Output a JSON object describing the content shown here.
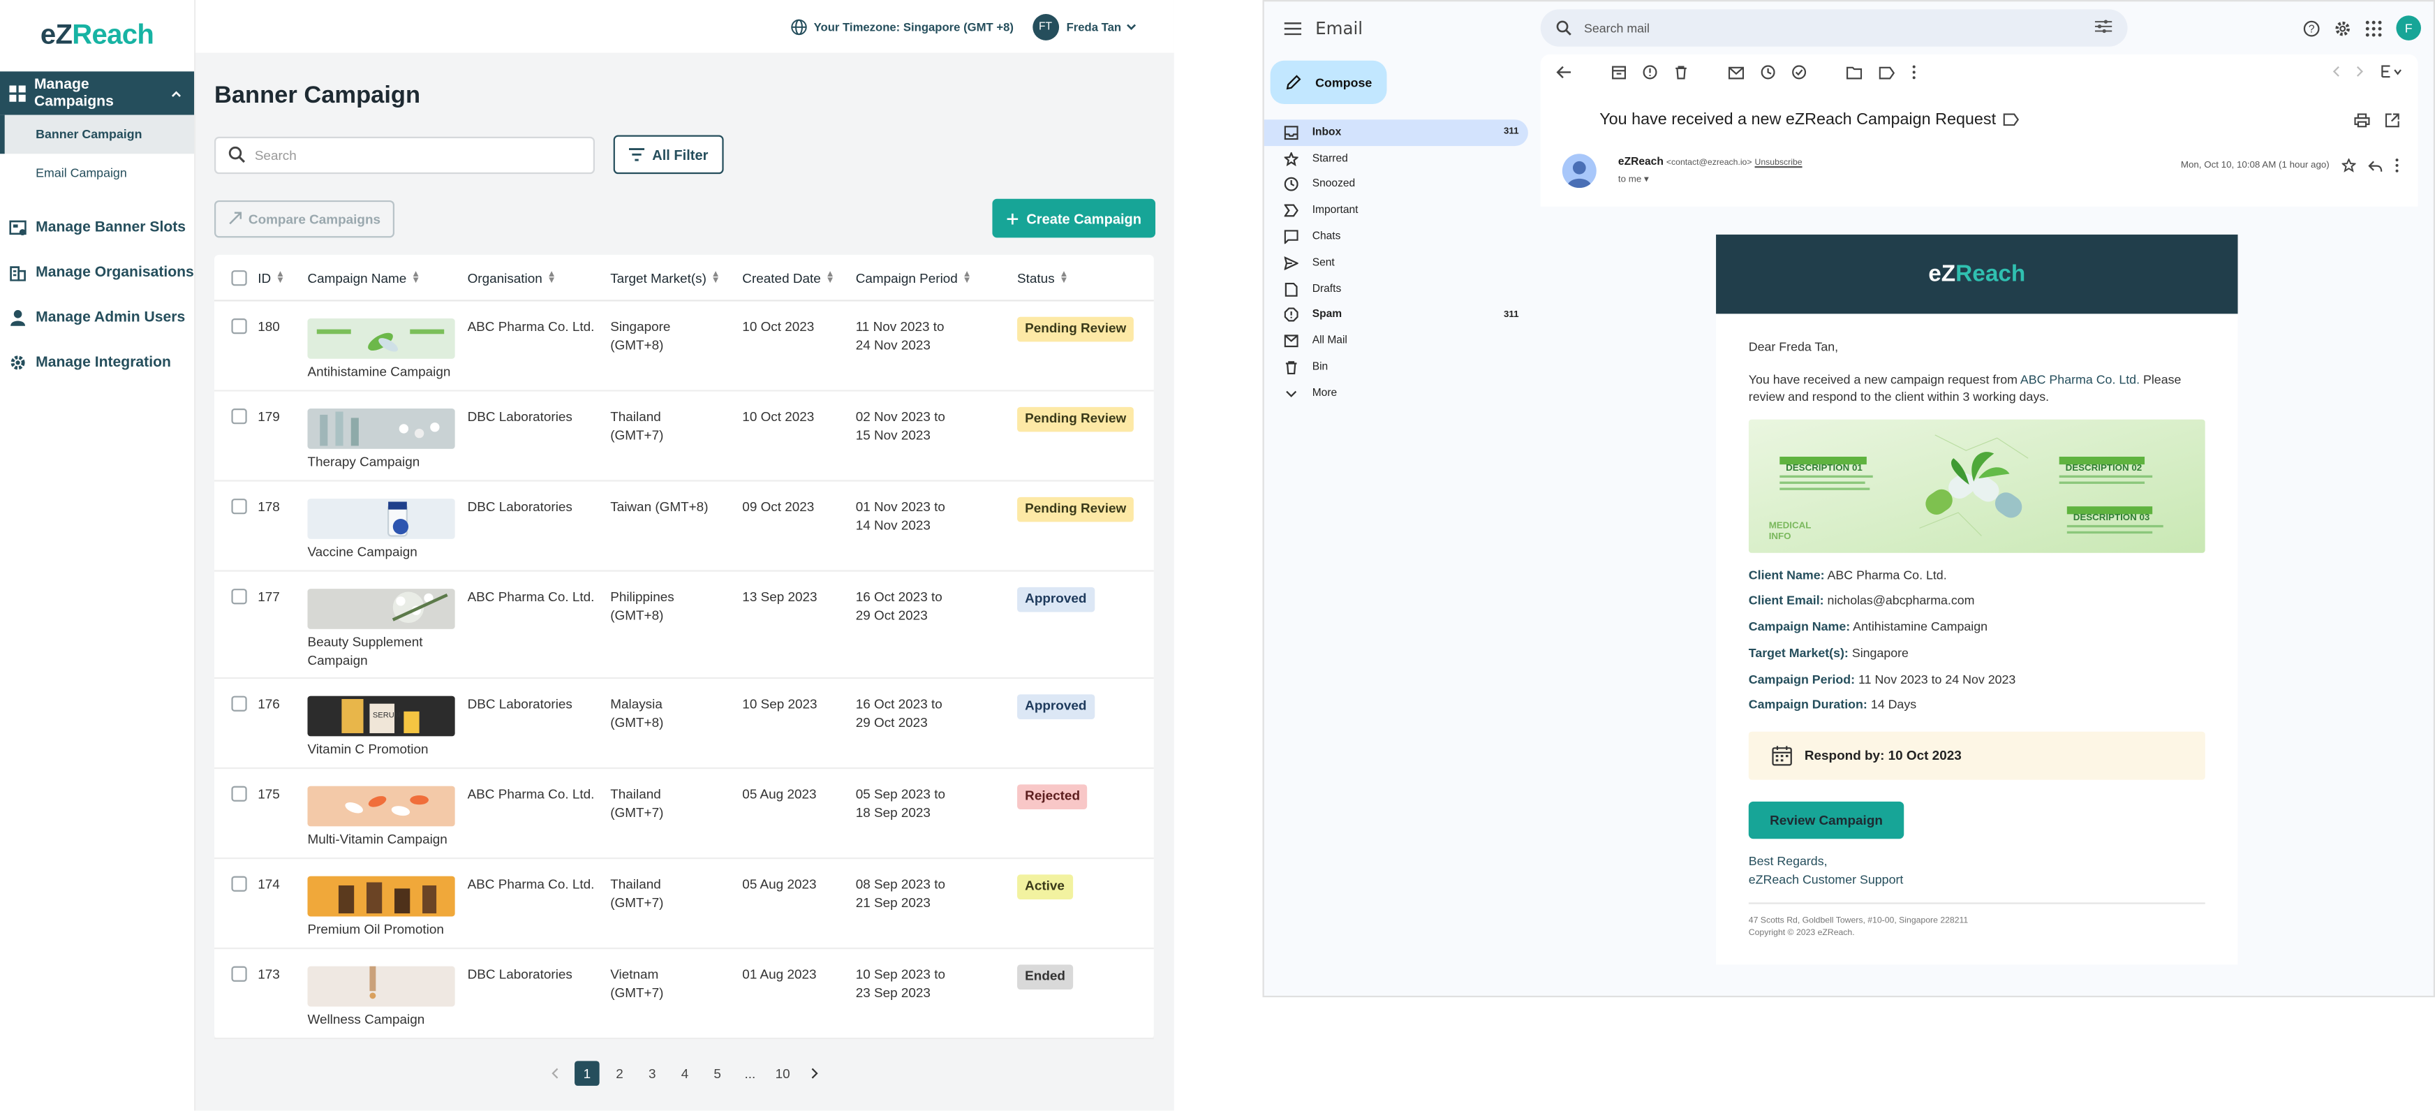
{
  "app": {
    "logo": {
      "part1": "eZ",
      "part2": "Reach"
    },
    "sidebar": {
      "section": "Manage Campaigns",
      "subitems": [
        {
          "label": "Banner Campaign",
          "active": true
        },
        {
          "label": "Email Campaign",
          "active": false
        }
      ],
      "items": [
        {
          "label": "Manage Banner Slots",
          "icon": "banner-slots-icon"
        },
        {
          "label": "Manage Organisations",
          "icon": "building-icon"
        },
        {
          "label": "Manage Admin Users",
          "icon": "user-icon"
        },
        {
          "label": "Manage Integration",
          "icon": "gear-icon"
        }
      ]
    },
    "topbar": {
      "timezone": "Your Timezone: Singapore (GMT +8)",
      "avatar_initials": "FT",
      "user_name": "Freda Tan"
    },
    "page_title": "Banner Campaign",
    "search_placeholder": "Search",
    "filter_label": "All Filter",
    "compare_label": "Compare Campaigns",
    "create_label": "Create Campaign",
    "columns": [
      "ID",
      "Campaign Name",
      "Organisation",
      "Target Market(s)",
      "Created Date",
      "Campaign Period",
      "Status"
    ],
    "rows": [
      {
        "id": "180",
        "name": "Antihistamine Campaign",
        "org": "ABC Pharma Co. Ltd.",
        "market": "Singapore (GMT+8)",
        "created": "10 Oct 2023",
        "period": "11 Nov 2023 to 24 Nov 2023",
        "status": "Pending Review",
        "thumb": "leaves"
      },
      {
        "id": "179",
        "name": "Therapy Campaign",
        "org": "DBC Laboratories",
        "market": "Thailand (GMT+7)",
        "created": "10 Oct 2023",
        "period": "02 Nov 2023 to 15 Nov 2023",
        "status": "Pending Review",
        "thumb": "lab"
      },
      {
        "id": "178",
        "name": "Vaccine Campaign",
        "org": "DBC Laboratories",
        "market": "Taiwan (GMT+8)",
        "created": "09 Oct 2023",
        "period": "01 Nov 2023 to 14 Nov 2023",
        "status": "Pending Review",
        "thumb": "vial"
      },
      {
        "id": "177",
        "name": "Beauty Supplement Campaign",
        "org": "ABC Pharma Co. Ltd.",
        "market": "Philippines (GMT+8)",
        "created": "13 Sep 2023",
        "period": "16 Oct 2023 to 29 Oct 2023",
        "status": "Approved",
        "thumb": "flowers"
      },
      {
        "id": "176",
        "name": "Vitamin C Promotion",
        "org": "DBC Laboratories",
        "market": "Malaysia (GMT+8)",
        "created": "10 Sep 2023",
        "period": "16 Oct 2023 to 29 Oct 2023",
        "status": "Approved",
        "thumb": "serum"
      },
      {
        "id": "175",
        "name": "Multi-Vitamin Campaign",
        "org": "ABC Pharma Co. Ltd.",
        "market": "Thailand (GMT+7)",
        "created": "05 Aug 2023",
        "period": "05 Sep 2023 to 18 Sep 2023",
        "status": "Rejected",
        "thumb": "pills"
      },
      {
        "id": "174",
        "name": "Premium Oil Promotion",
        "org": "ABC Pharma Co. Ltd.",
        "market": "Thailand (GMT+7)",
        "created": "05 Aug 2023",
        "period": "08 Sep 2023 to 21 Sep 2023",
        "status": "Active",
        "thumb": "oil"
      },
      {
        "id": "173",
        "name": "Wellness Campaign",
        "org": "DBC Laboratories",
        "market": "Vietnam (GMT+7)",
        "created": "01 Aug 2023",
        "period": "10 Sep 2023 to 23 Sep 2023",
        "status": "Ended",
        "thumb": "dropper"
      }
    ],
    "status_colors": {
      "Pending Review": {
        "bg": "#fde9a6",
        "fg": "#3a3a1a"
      },
      "Approved": {
        "bg": "#dce7f5",
        "fg": "#1e3a5c"
      },
      "Rejected": {
        "bg": "#f8c7c7",
        "fg": "#5c1e1e"
      },
      "Active": {
        "bg": "#f2f2a0",
        "fg": "#3a3a1a"
      },
      "Ended": {
        "bg": "#d9d9d9",
        "fg": "#333333"
      }
    },
    "pagination": {
      "pages": [
        "1",
        "2",
        "3",
        "4",
        "5",
        "...",
        "10"
      ],
      "current": "1"
    }
  },
  "gmail": {
    "brand": "Email",
    "search_placeholder": "Search mail",
    "avatar": "F",
    "compose": "Compose",
    "nav": [
      {
        "label": "Inbox",
        "count": "311",
        "icon": "inbox-icon",
        "active": true
      },
      {
        "label": "Starred",
        "count": "",
        "icon": "star-icon"
      },
      {
        "label": "Snoozed",
        "count": "",
        "icon": "clock-icon"
      },
      {
        "label": "Important",
        "count": "",
        "icon": "important-icon"
      },
      {
        "label": "Chats",
        "count": "",
        "icon": "chat-icon"
      },
      {
        "label": "Sent",
        "count": "",
        "icon": "send-icon"
      },
      {
        "label": "Drafts",
        "count": "",
        "icon": "draft-icon"
      },
      {
        "label": "Spam",
        "count": "311",
        "icon": "spam-icon",
        "bold": true
      },
      {
        "label": "All Mail",
        "count": "",
        "icon": "mail-icon"
      },
      {
        "label": "Bin",
        "count": "",
        "icon": "trash-icon"
      },
      {
        "label": "More",
        "count": "",
        "icon": "chevron-down-icon"
      }
    ],
    "subject": "You have received a new eZReach Campaign Request",
    "sender_name": "eZReach",
    "sender_email": "<contact@ezreach.io>",
    "unsubscribe": "Unsubscribe",
    "to": "to me",
    "time": "Mon, Oct 10, 10:08 AM (1 hour ago)",
    "email": {
      "dear": "Dear Freda Tan,",
      "intro_prefix": "You have received a new campaign request from ",
      "intro_client": "ABC Pharma Co. Ltd.",
      "intro_suffix": "Please review and respond to the client within 3 working days.",
      "banner": {
        "desc1": "DESCRIPTION 01",
        "desc2": "DESCRIPTION 02",
        "desc3": "DESCRIPTION 03",
        "medical1": "MEDICAL",
        "medical2": "INFO"
      },
      "details": [
        {
          "label": "Client Name:",
          "value": "ABC Pharma Co. Ltd."
        },
        {
          "label": "Client Email:",
          "value": "nicholas@abcpharma.com"
        },
        {
          "label": "Campaign Name:",
          "value": "Antihistamine Campaign"
        },
        {
          "label": "Target Market(s):",
          "value": "Singapore"
        },
        {
          "label": "Campaign Period:",
          "value": "11 Nov 2023 to 24 Nov 2023"
        },
        {
          "label": "Campaign Duration:",
          "value": "14 Days"
        }
      ],
      "respond_by": "Respond by: 10 Oct 2023",
      "button": "Review Campaign",
      "regards1": "Best Regards,",
      "regards2": "eZReach Customer Support",
      "address": "47 Scotts Rd, Goldbell Towers, #10-00, Singapore 228211",
      "copyright": "Copyright © 2023 eZReach."
    }
  }
}
